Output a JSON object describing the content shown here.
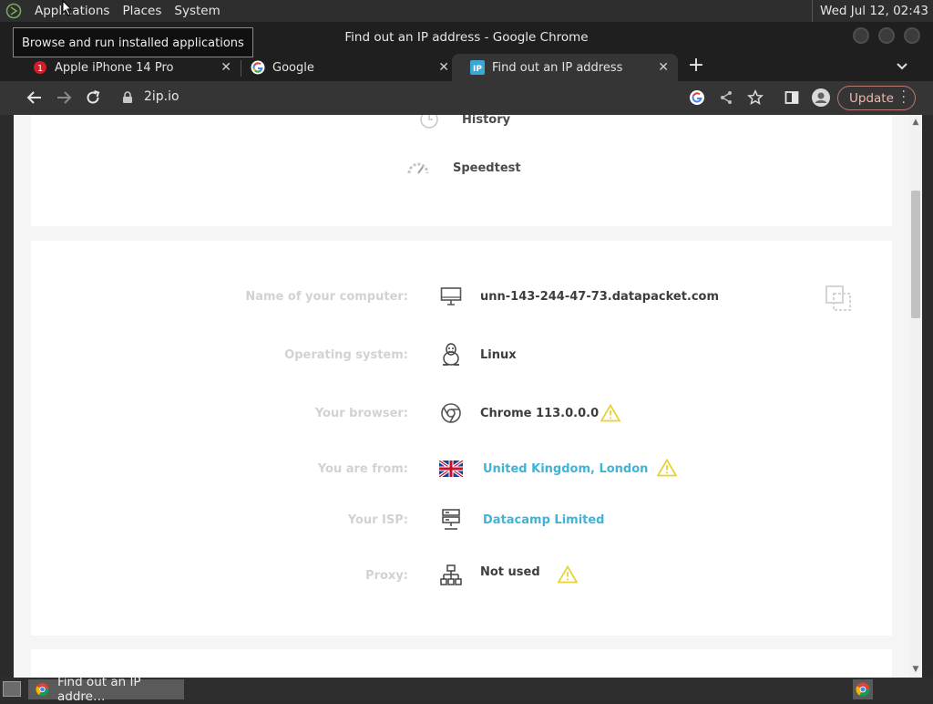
{
  "system_panel": {
    "menus": [
      "Applications",
      "Places",
      "System"
    ],
    "clock": "Wed Jul 12, 02:43",
    "tooltip": "Browse and run installed applications"
  },
  "window": {
    "title": "Find out an IP address - Google Chrome"
  },
  "tabs": [
    {
      "label": "Apple iPhone 14 Pro",
      "badge": "1",
      "favicon": "notification-badge-icon"
    },
    {
      "label": "Google",
      "favicon": "google-g-icon"
    },
    {
      "label": "Find out an IP address",
      "favicon": "ip-icon",
      "favicon_text": "IP",
      "active": true
    }
  ],
  "toolbar": {
    "url": "2ip.io",
    "update_label": "Update",
    "icons": [
      "back-arrow-icon",
      "forward-arrow-icon",
      "reload-icon",
      "lock-icon",
      "google-lens-icon",
      "share-icon",
      "bookmark-star-icon",
      "side-panel-icon",
      "profile-avatar-icon",
      "kebab-menu-icon"
    ]
  },
  "top_menu": {
    "items": [
      {
        "label": "History",
        "icon": "history-clock-icon"
      },
      {
        "label": "Speedtest",
        "icon": "speedometer-icon"
      }
    ]
  },
  "info_rows": [
    {
      "label": "Name of your computer:",
      "value": "unn-143-244-47-73.datapacket.com",
      "icon": "monitor-icon",
      "link": false,
      "warning": false
    },
    {
      "label": "Operating system:",
      "value": "Linux",
      "icon": "linux-penguin-icon",
      "link": false,
      "warning": false
    },
    {
      "label": "Your browser:",
      "value": "Chrome 113.0.0.0",
      "icon": "chrome-icon",
      "link": false,
      "warning": true
    },
    {
      "label": "You are from:",
      "value": "United Kingdom, London",
      "icon": "uk-flag-icon",
      "link": true,
      "warning": true
    },
    {
      "label": "Your ISP:",
      "value": "Datacamp Limited",
      "icon": "server-icon",
      "link": true,
      "warning": false
    },
    {
      "label": "Proxy:",
      "value": "Not used",
      "icon": "network-hierarchy-icon",
      "link": false,
      "warning": true
    }
  ],
  "taskbar": {
    "window_label": "Find out an IP addre…"
  },
  "colors": {
    "accent_link": "#40b3d6",
    "warning": "#e8d23a",
    "update_button": "#f2b8a9"
  }
}
